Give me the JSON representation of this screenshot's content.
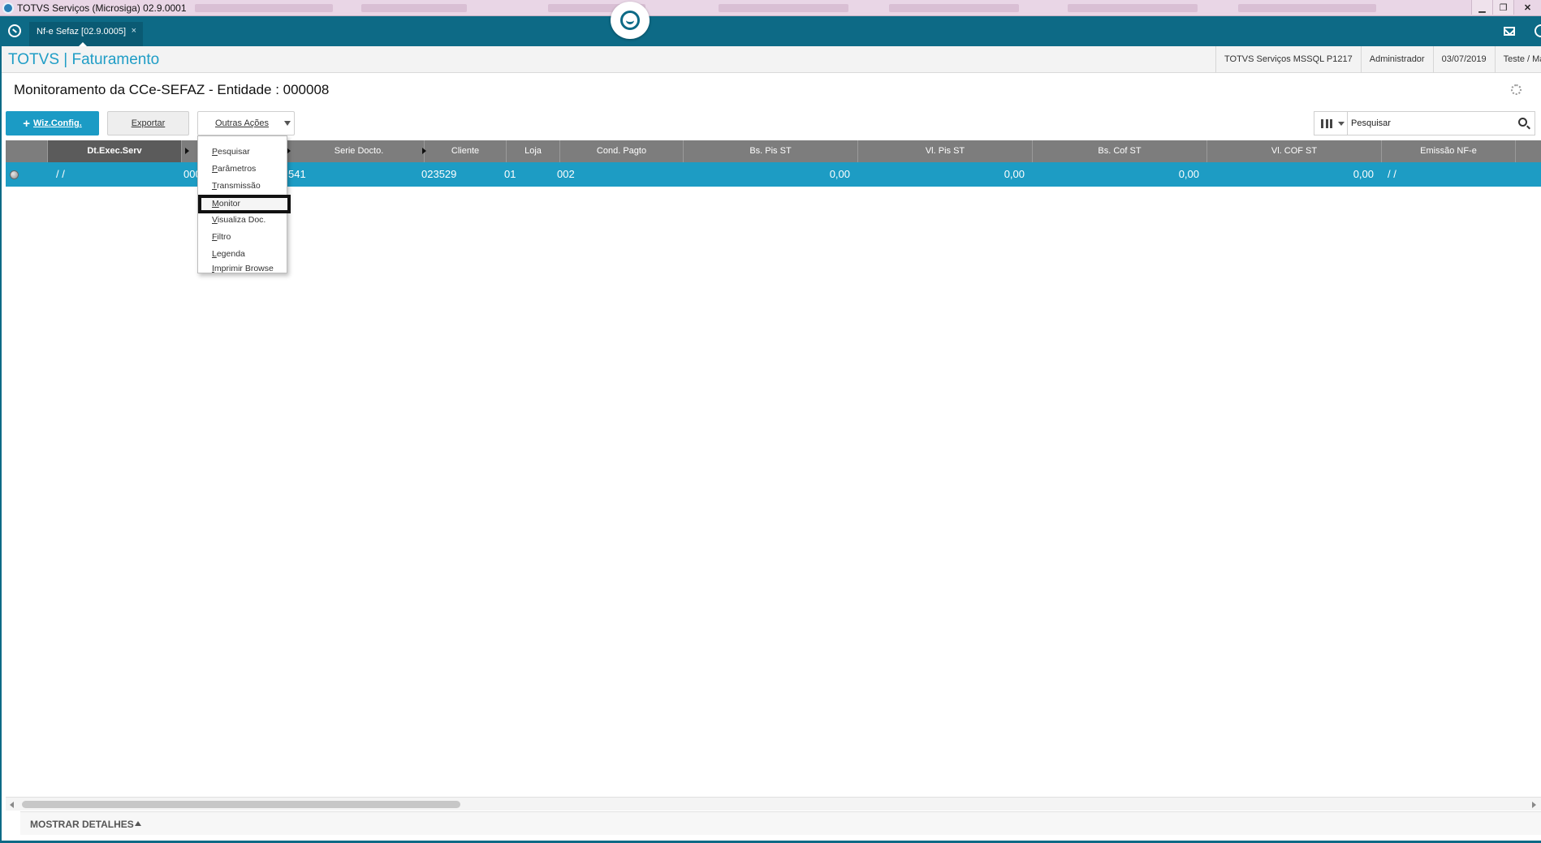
{
  "window": {
    "title": "TOTVS Serviços (Microsiga) 02.9.0001",
    "minimize": "▁",
    "restore": "❐",
    "close": "✕"
  },
  "tabbar": {
    "tab_label": "Nf-e Sefaz [02.9.0005]",
    "tab_close": "×"
  },
  "header": {
    "brand": "TOTVS | Faturamento",
    "environment": "TOTVS Serviços MSSQL P1217",
    "user": "Administrador",
    "date": "03/07/2019",
    "company": "Teste / Matr"
  },
  "page": {
    "title": "Monitoramento da CCe-SEFAZ - Entidade : 000008"
  },
  "toolbar": {
    "wiz_label": "Wiz.Config.",
    "export_label": "Exportar",
    "more_actions_label": "Outras Ações"
  },
  "search": {
    "value": "Pesquisar"
  },
  "grid": {
    "columns": [
      "Dt.Exec.Serv",
      "Serie Docto.",
      "Cliente",
      "Loja",
      "Cond. Pagto",
      "Bs. Pis ST",
      "Vl. Pis ST",
      "Bs. Cof ST",
      "Vl. COF ST",
      "Emissão NF-e"
    ],
    "row": {
      "dt_exec_serv": "/ /",
      "numero": "000",
      "serie_docto": "541",
      "cliente": "023529",
      "loja": "01",
      "cond_pagto": "002",
      "bs_pis_st": "0,00",
      "vl_pis_st": "0,00",
      "bs_cof_st": "0,00",
      "vl_cof_st": "0,00",
      "emissao_nfe": "/ /"
    }
  },
  "menu": {
    "items": [
      {
        "first": "P",
        "rest": "esquisar"
      },
      {
        "first": "P",
        "rest": "arâmetros"
      },
      {
        "first": "T",
        "rest": "ransmissão"
      },
      {
        "first": "M",
        "rest": "onitor"
      },
      {
        "first": "V",
        "rest": "isualiza Doc."
      },
      {
        "first": "F",
        "rest": "iltro"
      },
      {
        "first": "L",
        "rest": "egenda"
      },
      {
        "first": "I",
        "rest": "mprimir Browse"
      }
    ]
  },
  "footer": {
    "details_label": "MOSTRAR DETALHES"
  },
  "colors": {
    "accent": "#1d9cc4",
    "tabbar": "#0d6a86",
    "grid_header": "#7d7d7d"
  }
}
